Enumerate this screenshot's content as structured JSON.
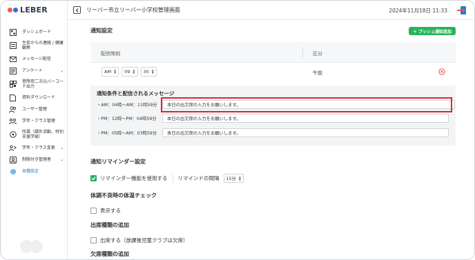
{
  "brand": {
    "name": "LEBER",
    "dot_colors": [
      "#e85a5a",
      "#2f6fd1",
      "#d0d4d9"
    ]
  },
  "sidebar": {
    "items": [
      {
        "label": "ダッシュボード",
        "icon": "dashboard-icon",
        "chevron": false
      },
      {
        "label": "生徒からの連絡 / 健康観察",
        "icon": "contact-icon",
        "chevron": false
      },
      {
        "label": "メッセージ配信",
        "icon": "mail-icon",
        "chevron": false
      },
      {
        "label": "アンケート",
        "icon": "survey-icon",
        "chevron": true
      },
      {
        "label": "登降用二次元バーコード出力",
        "icon": "qrcode-icon",
        "chevron": false
      },
      {
        "label": "資料ダウンロード",
        "icon": "document-icon",
        "chevron": false
      },
      {
        "label": "ユーザー管理",
        "icon": "users-icon",
        "chevron": false
      },
      {
        "label": "学年・クラス管理",
        "icon": "class-icon",
        "chevron": false
      },
      {
        "label": "所属（課外活動、特別支援学級）",
        "icon": "group-icon",
        "chevron": false
      },
      {
        "label": "学年・クラス変更",
        "icon": "class-change-icon",
        "chevron": true
      },
      {
        "label": "制限付き管理者",
        "icon": "admin-icon",
        "chevron": true
      },
      {
        "label": "各種設定",
        "icon": "gear-icon",
        "chevron": false
      }
    ]
  },
  "header": {
    "title": "リーバー市立リーバー小学校管理画面",
    "datetime": "2024年11月18日 11:33"
  },
  "notification": {
    "section_title": "通知設定",
    "push_button": "プッシュ通知追加",
    "col_time": "配信時刻",
    "col_kubun": "区分",
    "time": {
      "ampm": "AM",
      "hour": "09",
      "minute": "30"
    },
    "kubun": "午前",
    "cond_title": "通知条件と配信されるメッセージ",
    "conditions": [
      {
        "label": "・AM：04時〜AM：11時59分",
        "message": "本日の出欠席の入力をお願いします。"
      },
      {
        "label": "・PM：12時〜PM：04時59分",
        "message": "本日の出欠席の入力をお願いします。"
      },
      {
        "label": "・PM：05時〜AM：03時59分",
        "message": "本日の出欠席の入力をお願いします。"
      }
    ]
  },
  "reminder": {
    "section_title": "通知リマインダー設定",
    "checkbox_label": "リマインダー機能を使用する",
    "checked": true,
    "interval_label": "リマインドの間隔",
    "interval_value": "15分"
  },
  "temperature": {
    "section_title": "体調不良時の体温チェック",
    "checkbox_label": "表示する",
    "checked": false
  },
  "attendance_type": {
    "section_title": "出席種類の追加",
    "checkbox_label": "出席する（放課後児童クラブは欠席）",
    "checked": false
  },
  "absence_type": {
    "section_title": "欠席種類の追加"
  },
  "colors": {
    "accent_green": "#27b35a",
    "active_blue": "#1f7fd1",
    "highlight_red": "#e0242b",
    "delete_red": "#e05555"
  }
}
